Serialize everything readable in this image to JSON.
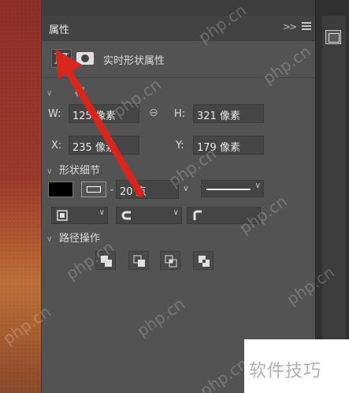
{
  "panel": {
    "title": "属性",
    "collapse_glyph": "»",
    "mode_label": "实时形状属性"
  },
  "frame_section": {
    "heading": "框",
    "w_label": "W:",
    "w_value": "125 像素",
    "h_label": "H:",
    "h_value": "321 像素",
    "x_label": "X:",
    "x_value": "235 像素",
    "y_label": "Y:",
    "y_value": "179 像素"
  },
  "shape_section": {
    "heading": "形状细节",
    "fill_color": "#000000",
    "stroke_width_value": "20 点"
  },
  "path_section": {
    "heading": "路径操作"
  },
  "overlay": {
    "text": "软件技巧"
  },
  "watermark": {
    "text": "php.cn"
  },
  "colors": {
    "arrow": "#d9261c",
    "panel_bg": "#535353"
  },
  "icons": [
    "shape-frame-icon",
    "mask-icon",
    "link-icon",
    "panel-menu-icon",
    "align-stroke-icon",
    "cap-icon",
    "corner-icon",
    "combine-icon",
    "subtract-icon",
    "intersect-icon",
    "exclude-icon"
  ]
}
